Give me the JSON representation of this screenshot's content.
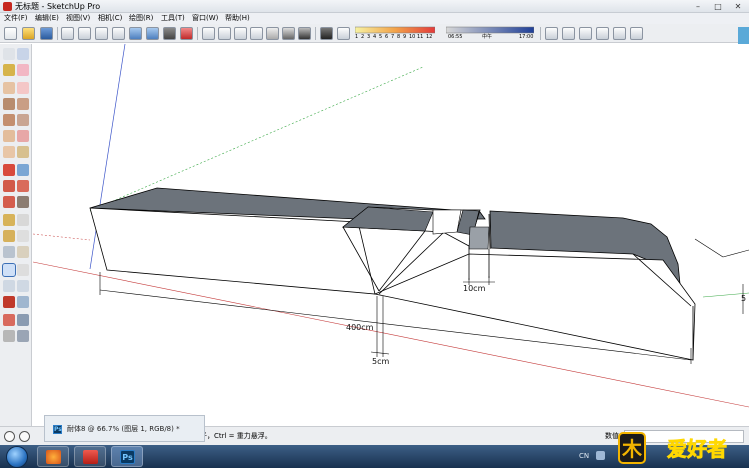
{
  "window": {
    "title": "无标题 - SketchUp Pro",
    "controls": {
      "minimize": "–",
      "maximize": "□",
      "close": "✕"
    }
  },
  "menu": {
    "items": [
      {
        "label": "文件(F)"
      },
      {
        "label": "编辑(E)"
      },
      {
        "label": "视图(V)"
      },
      {
        "label": "相机(C)"
      },
      {
        "label": "绘图(R)"
      },
      {
        "label": "工具(T)"
      },
      {
        "label": "窗口(W)"
      },
      {
        "label": "帮助(H)"
      }
    ]
  },
  "shadow_settings": {
    "months": [
      "1",
      "2",
      "3",
      "4",
      "5",
      "6",
      "7",
      "8",
      "9",
      "10",
      "11",
      "12"
    ],
    "start_time": "06:55",
    "midday_label": "中午",
    "end_time": "17:00"
  },
  "viewport": {
    "dimension_labels": {
      "length": "400cm",
      "width_small": "5cm",
      "gap": "10cm",
      "height_partial": "5"
    },
    "colors": {
      "top_face": "#6c737b",
      "front_face": "#ffffff",
      "edge": "#000000",
      "axis_red": "#c43a3a",
      "axis_green": "#39a845",
      "axis_blue": "#3b54c9"
    }
  },
  "status_bar": {
    "hint_text": "子，Ctrl = 重力悬浮。",
    "measure_label": "数值"
  },
  "popup": {
    "app_badge": "Ps",
    "document_info": "耐体8 @ 66.7% (图层 1, RGB/8) *"
  },
  "taskbar": {
    "photoshop_badge": "Ps",
    "tray_language": "CN"
  },
  "watermark": {
    "brand": "爱好者",
    "icon_glyph": "木"
  },
  "accent_colors": {
    "title_icon": "#c6271f",
    "taskbar_top": "#3d5f86",
    "taskbar_bottom": "#18314f"
  }
}
